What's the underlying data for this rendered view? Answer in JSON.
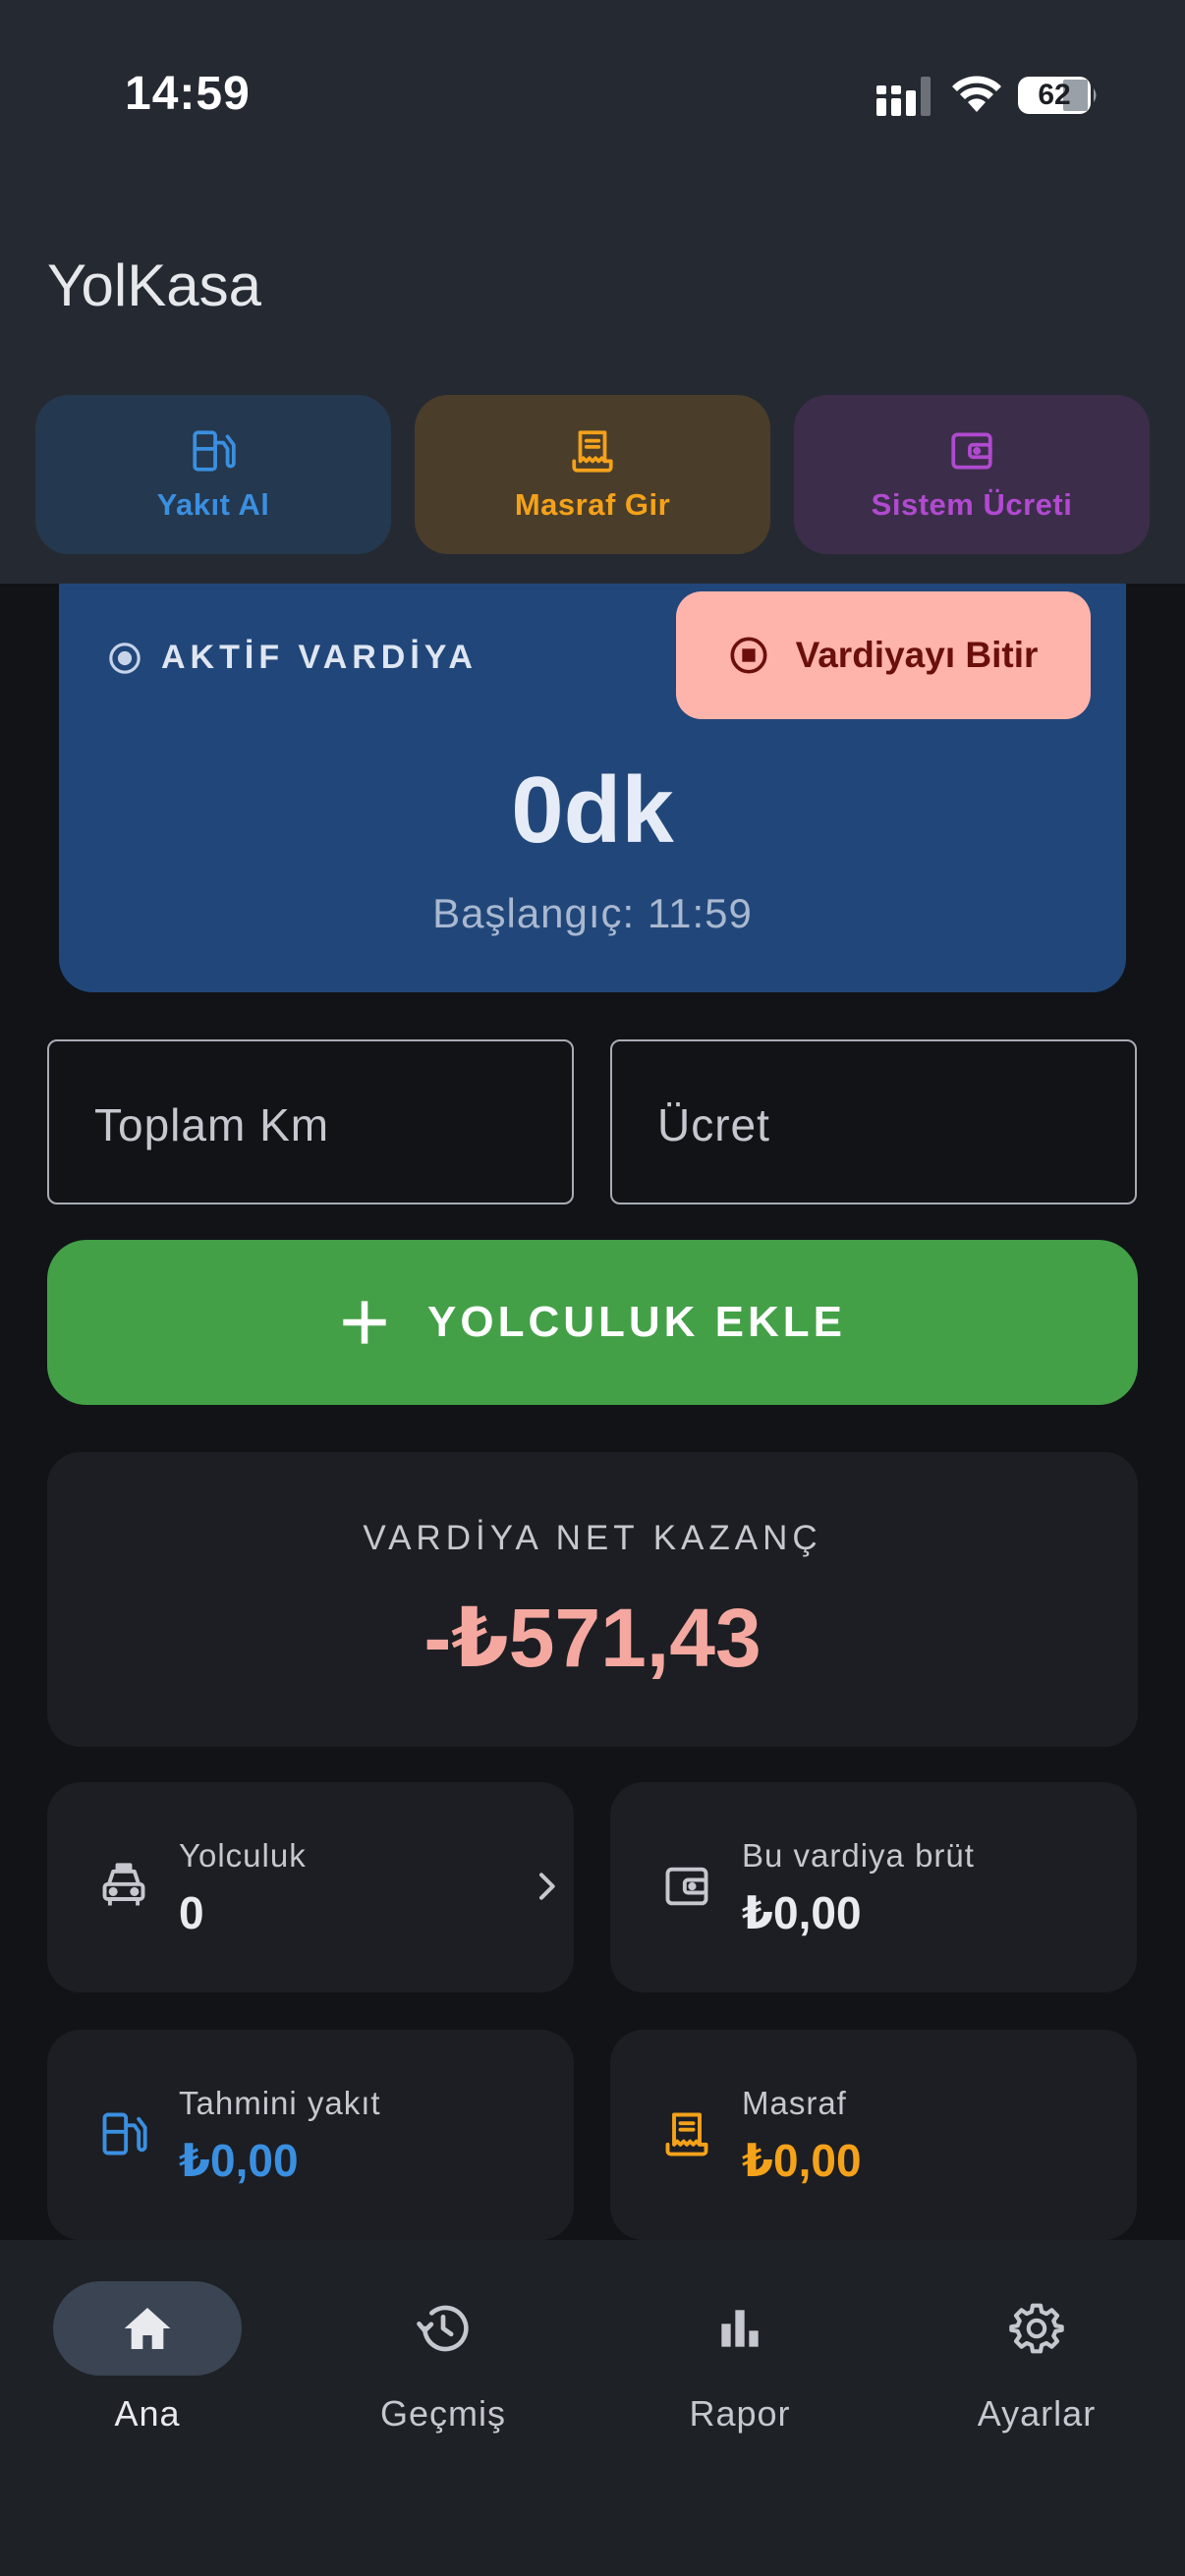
{
  "status_bar": {
    "time": "14:59",
    "battery": "62"
  },
  "app": {
    "title": "YolKasa"
  },
  "quick_actions": [
    {
      "label": "Yakıt Al",
      "icon": "fuel-pump-icon",
      "color": "#3b8fe0"
    },
    {
      "label": "Masraf Gir",
      "icon": "receipt-icon",
      "color": "#f4a21a"
    },
    {
      "label": "Sistem Ücreti",
      "icon": "wallet-icon",
      "color": "#b14ad0"
    }
  ],
  "shift": {
    "status_label": "AKTİF VARDİYA",
    "end_button": "Vardiyayı Bitir",
    "duration": "0dk",
    "start": "Başlangıç: 11:59"
  },
  "inputs": {
    "km_placeholder": "Toplam Km",
    "fee_placeholder": "Ücret"
  },
  "add_ride": {
    "label": "YOLCULUK EKLE"
  },
  "net": {
    "label": "VARDİYA NET KAZANÇ",
    "value": "-₺571,43"
  },
  "tiles": {
    "rides": {
      "label": "Yolculuk",
      "value": "0",
      "icon": "taxi-icon"
    },
    "gross": {
      "label": "Bu vardiya brüt",
      "value": "₺0,00",
      "icon": "wallet-icon"
    },
    "fuel": {
      "label": "Tahmini yakıt",
      "value": "₺0,00",
      "icon": "fuel-pump-icon"
    },
    "expense": {
      "label": "Masraf",
      "value": "₺0,00",
      "icon": "receipt-icon"
    }
  },
  "nav": [
    {
      "label": "Ana",
      "icon": "home-icon",
      "active": true
    },
    {
      "label": "Geçmiş",
      "icon": "history-icon",
      "active": false
    },
    {
      "label": "Rapor",
      "icon": "bar-chart-icon",
      "active": false
    },
    {
      "label": "Ayarlar",
      "icon": "gear-icon",
      "active": false
    }
  ],
  "colors": {
    "header_bg": "#252a32",
    "shift_card_bg": "#21477a",
    "end_shift_bg": "#ffb4ab",
    "add_ride_bg": "#43a047",
    "net_value": "#f4a8a0"
  }
}
